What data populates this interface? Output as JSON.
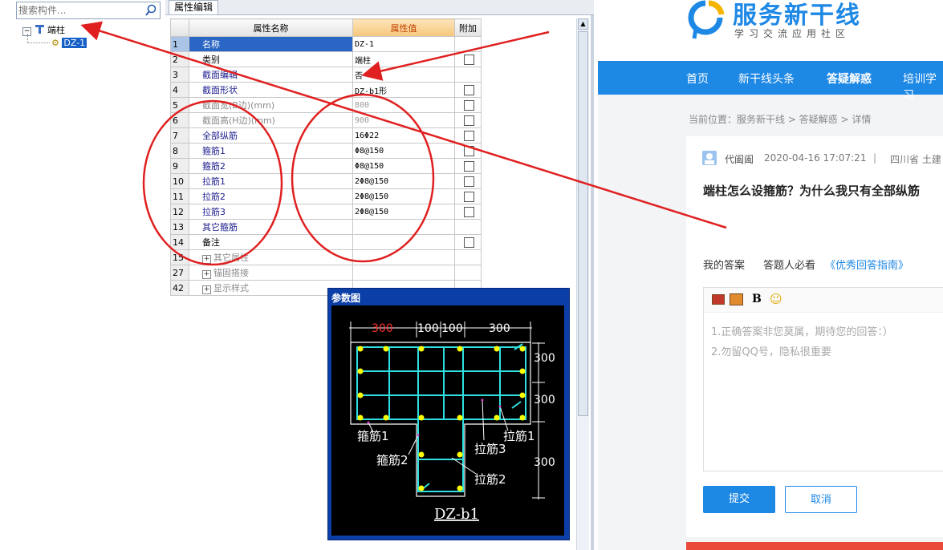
{
  "tree": {
    "search_placeholder": "搜索构件...",
    "root_label": "端柱",
    "child_label": "DZ-1"
  },
  "props": {
    "tab_label": "属性编辑",
    "headers": {
      "name": "属性名称",
      "value": "属性值",
      "extra": "附加"
    },
    "rows": [
      {
        "num": "1",
        "name": "名称",
        "value": "DZ-1",
        "checkbox": false
      },
      {
        "num": "2",
        "name": "类别",
        "value": "端柱",
        "checkbox": true
      },
      {
        "num": "3",
        "name": "截面编辑",
        "value": "否",
        "checkbox": false
      },
      {
        "num": "4",
        "name": "截面形状",
        "value": "DZ-b1形",
        "checkbox": true
      },
      {
        "num": "5",
        "name": "截面宽(B边)(mm)",
        "value": "800",
        "checkbox": true
      },
      {
        "num": "6",
        "name": "截面高(H边)(mm)",
        "value": "900",
        "checkbox": true
      },
      {
        "num": "7",
        "name": "全部纵筋",
        "value": "16Φ22",
        "checkbox": true
      },
      {
        "num": "8",
        "name": "箍筋1",
        "value": "Φ8@150",
        "checkbox": true
      },
      {
        "num": "9",
        "name": "箍筋2",
        "value": "Φ8@150",
        "checkbox": true
      },
      {
        "num": "10",
        "name": "拉筋1",
        "value": "2Φ8@150",
        "checkbox": true
      },
      {
        "num": "11",
        "name": "拉筋2",
        "value": "2Φ8@150",
        "checkbox": true
      },
      {
        "num": "12",
        "name": "拉筋3",
        "value": "2Φ8@150",
        "checkbox": true
      },
      {
        "num": "13",
        "name": "其它箍筋",
        "value": "",
        "checkbox": false
      },
      {
        "num": "14",
        "name": "备注",
        "value": "",
        "checkbox": true
      }
    ],
    "groups": [
      {
        "num": "15",
        "label": "其它属性"
      },
      {
        "num": "27",
        "label": "锚固搭接"
      },
      {
        "num": "42",
        "label": "显示样式"
      }
    ]
  },
  "diagram": {
    "title": "参数图",
    "dims_top": [
      "300",
      "100",
      "100",
      "300"
    ],
    "dims_right": [
      "300",
      "300",
      "300"
    ],
    "labels": {
      "gujin1": "箍筋1",
      "gujin2": "箍筋2",
      "lajin1": "拉筋1",
      "lajin2": "拉筋2",
      "lajin3": "拉筋3"
    },
    "caption": "DZ-b1"
  },
  "web": {
    "brand_name": "服务新干线",
    "brand_sub": "学习交流应用社区",
    "nav": [
      "首页",
      "新干线头条",
      "答疑解惑",
      "培训学习"
    ],
    "breadcrumb": "当前位置：服务新干线 > 答疑解惑 > 详情",
    "author": "代阖阖",
    "datetime": "2020-04-16 17:07:21",
    "separator": "|",
    "region": "四川省 土建",
    "question": "端柱怎么设箍筋？为什么我只有全部纵筋",
    "answer_tab": "我的答案",
    "must_read": "答题人必看",
    "guide_link": "《优秀回答指南》",
    "bold_label": "B",
    "placeholder_line1": "1.正确答案非您莫属，期待您的回答：）",
    "placeholder_line2": "2.勿留QQ号，隐私很重要",
    "submit": "提交",
    "cancel": "取消",
    "accent": "#1e88e5"
  },
  "annotation_color": "#e02020"
}
